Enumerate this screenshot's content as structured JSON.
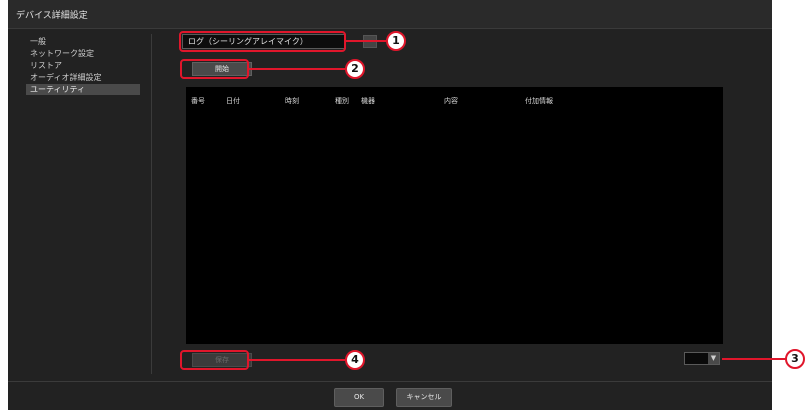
{
  "window": {
    "title": "デバイス詳細設定"
  },
  "sidebar": {
    "items": [
      {
        "label": "一般"
      },
      {
        "label": "ネットワーク設定"
      },
      {
        "label": "リストア"
      },
      {
        "label": "オーディオ詳細設定"
      },
      {
        "label": "ユーティリティ",
        "selected": true
      }
    ]
  },
  "main": {
    "log_select_value": "ログ（シーリングアレイマイク）",
    "start_button_label": "開始",
    "table": {
      "columns": [
        "番号",
        "日付",
        "時刻",
        "種別",
        "機器",
        "内容",
        "付加情報"
      ],
      "rows": []
    },
    "save_button_label": "保存",
    "page_select_arrow": "▼"
  },
  "footer": {
    "ok_label": "OK",
    "cancel_label": "キャンセル"
  },
  "callouts": {
    "c1": "1",
    "c2": "2",
    "c3": "3",
    "c4": "4"
  },
  "colors": {
    "accent": "#e0162b",
    "background": "#222222",
    "table_bg": "#000000"
  }
}
